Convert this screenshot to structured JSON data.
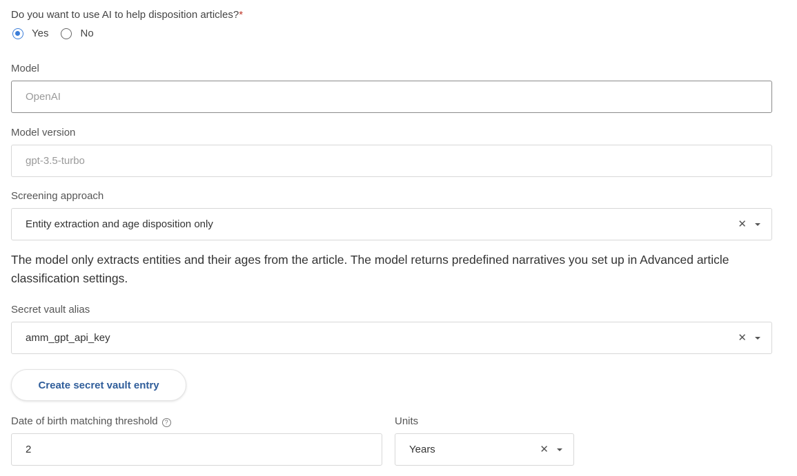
{
  "ai_question": {
    "label": "Do you want to use AI to help disposition articles?",
    "required_mark": "*",
    "options": [
      {
        "label": "Yes",
        "selected": true
      },
      {
        "label": "No",
        "selected": false
      }
    ]
  },
  "model": {
    "label": "Model",
    "placeholder": "OpenAI"
  },
  "model_version": {
    "label": "Model version",
    "placeholder": "gpt-3.5-turbo"
  },
  "screening_approach": {
    "label": "Screening approach",
    "value": "Entity extraction and age disposition only",
    "clear_glyph": "✕"
  },
  "description": "The model only extracts entities and their ages from the article. The model returns predefined narratives you set up in Advanced article classification settings.",
  "secret_vault_alias": {
    "label": "Secret vault alias",
    "value": "amm_gpt_api_key",
    "clear_glyph": "✕"
  },
  "create_secret_button": {
    "label": "Create secret vault entry"
  },
  "dob_threshold": {
    "label": "Date of birth matching threshold",
    "help_glyph": "?",
    "value": "2"
  },
  "units": {
    "label": "Units",
    "value": "Years",
    "clear_glyph": "✕"
  },
  "icons": {
    "radio": "radio-icon",
    "clear": "close-icon",
    "caret": "caret-down-icon",
    "help": "help-circle-icon"
  },
  "colors": {
    "accent": "#3b7dd8",
    "button_text": "#2f5d9a",
    "required": "#c0392b"
  }
}
